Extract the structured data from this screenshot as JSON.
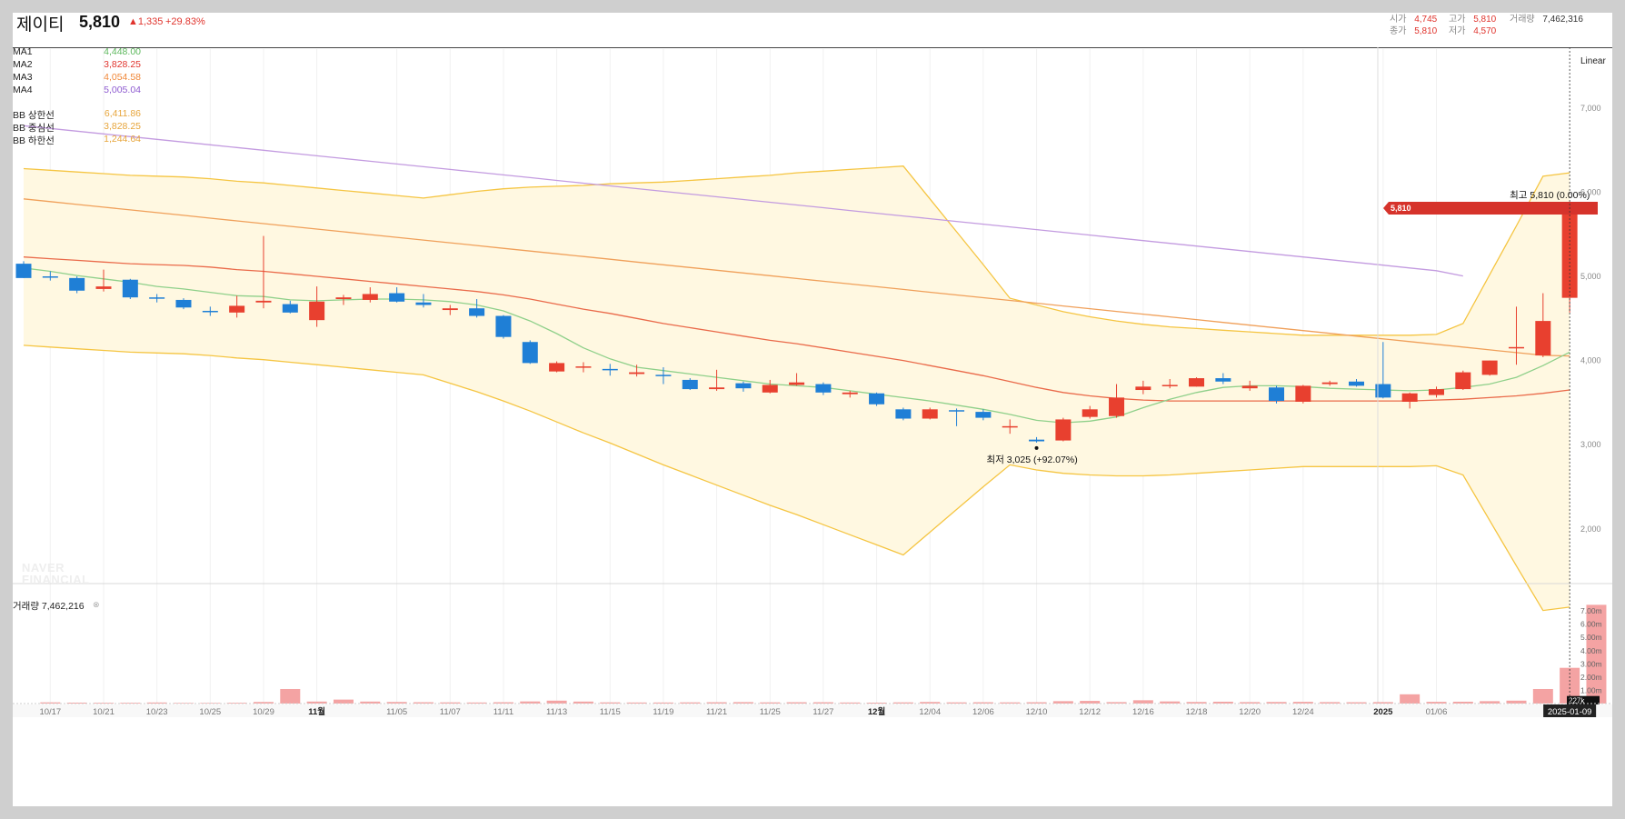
{
  "header": {
    "name": "제이티",
    "price": "5,810",
    "change": "▲1,335",
    "change_rate": "+29.83%",
    "open_label": "시가",
    "open_value": "4,745",
    "high_label": "고가",
    "high_value": "5,810",
    "volume_label": "거래량",
    "volume_value": "7,462,316",
    "close_label": "종가",
    "close_value": "5,810",
    "low_label": "저가",
    "low_value": "4,570"
  },
  "legend": [
    {
      "name": "MA1",
      "value": "4,448.00",
      "color": "#5cb85c"
    },
    {
      "name": "MA2",
      "value": "3,828.25",
      "color": "#e0342d"
    },
    {
      "name": "MA3",
      "value": "4,054.58",
      "color": "#f0883a"
    },
    {
      "name": "MA4",
      "value": "5,005.04",
      "color": "#8e5bd0"
    },
    {
      "name": "BB 상한선",
      "value": "6,411.86",
      "color": "#e7a53b"
    },
    {
      "name": "BB 중심선",
      "value": "3,828.25",
      "color": "#e7a53b"
    },
    {
      "name": "BB 하한선",
      "value": "1,244.64",
      "color": "#e7a53b"
    }
  ],
  "scale_mode": "Linear",
  "volume_legend": "거래량 7,462,216",
  "watermark": [
    "NAVER",
    "FINANCIAL"
  ],
  "colors": {
    "up": "#e8402f",
    "down": "#1f7fd6",
    "bb_band": "#f5c542",
    "bb_fill": "#fff8e1"
  },
  "chart_data": {
    "type": "candlestick",
    "price_axis_ticks": [
      "7,000",
      "6,000",
      "5,000",
      "4,000",
      "3,000",
      "2,000"
    ],
    "price_ylim": [
      1350,
      7700
    ],
    "volume_axis_ticks": [
      "7.00m",
      "6.00m",
      "5.00m",
      "4.00m",
      "3.00m",
      "2.00m",
      "1.00m"
    ],
    "volume_ylim": [
      0,
      7900000
    ],
    "x_tick_labels": [
      {
        "i": 1,
        "label": "10/17"
      },
      {
        "i": 3,
        "label": "10/21"
      },
      {
        "i": 5,
        "label": "10/23"
      },
      {
        "i": 7,
        "label": "10/25"
      },
      {
        "i": 9,
        "label": "10/29"
      },
      {
        "i": 11,
        "label": "11월"
      },
      {
        "i": 14,
        "label": "11/05"
      },
      {
        "i": 16,
        "label": "11/07"
      },
      {
        "i": 18,
        "label": "11/11"
      },
      {
        "i": 20,
        "label": "11/13"
      },
      {
        "i": 22,
        "label": "11/15"
      },
      {
        "i": 24,
        "label": "11/19"
      },
      {
        "i": 26,
        "label": "11/21"
      },
      {
        "i": 28,
        "label": "11/25"
      },
      {
        "i": 30,
        "label": "11/27"
      },
      {
        "i": 32,
        "label": "12월"
      },
      {
        "i": 34,
        "label": "12/04"
      },
      {
        "i": 36,
        "label": "12/06"
      },
      {
        "i": 38,
        "label": "12/10"
      },
      {
        "i": 40,
        "label": "12/12"
      },
      {
        "i": 42,
        "label": "12/16"
      },
      {
        "i": 44,
        "label": "12/18"
      },
      {
        "i": 46,
        "label": "12/20"
      },
      {
        "i": 48,
        "label": "12/24"
      },
      {
        "i": 51,
        "label": "2025"
      },
      {
        "i": 53,
        "label": "01/06"
      }
    ],
    "crosshair_date": "2025-01-09",
    "last_price_tag": "5,810",
    "last_volume_tag": "227k",
    "high_annotation": "최고 5,810 (0.00%)",
    "low_annotation": "최저 3,025 (+92.07%)",
    "candles": [
      {
        "o": 5150,
        "h": 5180,
        "l": 4980,
        "c": 4980
      },
      {
        "o": 5000,
        "h": 5060,
        "l": 4950,
        "c": 4990
      },
      {
        "o": 4980,
        "h": 5000,
        "l": 4800,
        "c": 4830
      },
      {
        "o": 4850,
        "h": 5080,
        "l": 4820,
        "c": 4880
      },
      {
        "o": 4960,
        "h": 4970,
        "l": 4730,
        "c": 4750
      },
      {
        "o": 4750,
        "h": 4790,
        "l": 4690,
        "c": 4740
      },
      {
        "o": 4720,
        "h": 4740,
        "l": 4610,
        "c": 4630
      },
      {
        "o": 4590,
        "h": 4640,
        "l": 4530,
        "c": 4580
      },
      {
        "o": 4570,
        "h": 4770,
        "l": 4510,
        "c": 4650
      },
      {
        "o": 4690,
        "h": 5480,
        "l": 4620,
        "c": 4710
      },
      {
        "o": 4670,
        "h": 4710,
        "l": 4560,
        "c": 4570
      },
      {
        "o": 4480,
        "h": 4880,
        "l": 4400,
        "c": 4700
      },
      {
        "o": 4730,
        "h": 4780,
        "l": 4660,
        "c": 4750
      },
      {
        "o": 4720,
        "h": 4870,
        "l": 4690,
        "c": 4790
      },
      {
        "o": 4800,
        "h": 4870,
        "l": 4690,
        "c": 4700
      },
      {
        "o": 4690,
        "h": 4790,
        "l": 4630,
        "c": 4660
      },
      {
        "o": 4600,
        "h": 4660,
        "l": 4540,
        "c": 4620
      },
      {
        "o": 4620,
        "h": 4730,
        "l": 4510,
        "c": 4530
      },
      {
        "o": 4530,
        "h": 4540,
        "l": 4260,
        "c": 4280
      },
      {
        "o": 4220,
        "h": 4240,
        "l": 3960,
        "c": 3970
      },
      {
        "o": 3870,
        "h": 3990,
        "l": 3860,
        "c": 3970
      },
      {
        "o": 3920,
        "h": 3980,
        "l": 3860,
        "c": 3930
      },
      {
        "o": 3900,
        "h": 3960,
        "l": 3820,
        "c": 3890
      },
      {
        "o": 3840,
        "h": 3950,
        "l": 3810,
        "c": 3860
      },
      {
        "o": 3830,
        "h": 3920,
        "l": 3720,
        "c": 3820
      },
      {
        "o": 3770,
        "h": 3790,
        "l": 3650,
        "c": 3660
      },
      {
        "o": 3660,
        "h": 3890,
        "l": 3640,
        "c": 3680
      },
      {
        "o": 3730,
        "h": 3750,
        "l": 3630,
        "c": 3670
      },
      {
        "o": 3620,
        "h": 3770,
        "l": 3610,
        "c": 3710
      },
      {
        "o": 3710,
        "h": 3850,
        "l": 3700,
        "c": 3740
      },
      {
        "o": 3720,
        "h": 3740,
        "l": 3590,
        "c": 3620
      },
      {
        "o": 3600,
        "h": 3640,
        "l": 3560,
        "c": 3620
      },
      {
        "o": 3610,
        "h": 3620,
        "l": 3460,
        "c": 3480
      },
      {
        "o": 3420,
        "h": 3440,
        "l": 3290,
        "c": 3310
      },
      {
        "o": 3310,
        "h": 3440,
        "l": 3300,
        "c": 3420
      },
      {
        "o": 3410,
        "h": 3430,
        "l": 3220,
        "c": 3400
      },
      {
        "o": 3390,
        "h": 3420,
        "l": 3290,
        "c": 3320
      },
      {
        "o": 3220,
        "h": 3300,
        "l": 3130,
        "c": 3220
      },
      {
        "o": 3060,
        "h": 3090,
        "l": 3025,
        "c": 3040
      },
      {
        "o": 3050,
        "h": 3320,
        "l": 3040,
        "c": 3300
      },
      {
        "o": 3330,
        "h": 3460,
        "l": 3310,
        "c": 3420
      },
      {
        "o": 3340,
        "h": 3720,
        "l": 3320,
        "c": 3560
      },
      {
        "o": 3650,
        "h": 3760,
        "l": 3600,
        "c": 3690
      },
      {
        "o": 3700,
        "h": 3780,
        "l": 3670,
        "c": 3710
      },
      {
        "o": 3690,
        "h": 3800,
        "l": 3690,
        "c": 3790
      },
      {
        "o": 3790,
        "h": 3850,
        "l": 3720,
        "c": 3750
      },
      {
        "o": 3670,
        "h": 3760,
        "l": 3640,
        "c": 3700
      },
      {
        "o": 3680,
        "h": 3700,
        "l": 3490,
        "c": 3520
      },
      {
        "o": 3510,
        "h": 3710,
        "l": 3490,
        "c": 3700
      },
      {
        "o": 3720,
        "h": 3760,
        "l": 3700,
        "c": 3740
      },
      {
        "o": 3750,
        "h": 3780,
        "l": 3690,
        "c": 3700
      },
      {
        "o": 3720,
        "h": 4220,
        "l": 3550,
        "c": 3560
      },
      {
        "o": 3510,
        "h": 3620,
        "l": 3430,
        "c": 3610
      },
      {
        "o": 3590,
        "h": 3690,
        "l": 3560,
        "c": 3660
      },
      {
        "o": 3660,
        "h": 3880,
        "l": 3650,
        "c": 3860
      },
      {
        "o": 3830,
        "h": 4000,
        "l": 3820,
        "c": 4000
      },
      {
        "o": 4150,
        "h": 4640,
        "l": 3950,
        "c": 4160
      },
      {
        "o": 4060,
        "h": 4800,
        "l": 4040,
        "c": 4470
      },
      {
        "o": 4745,
        "h": 5810,
        "l": 4570,
        "c": 5810
      }
    ],
    "volume": [
      90000,
      70000,
      60000,
      60000,
      80000,
      50000,
      50000,
      60000,
      120000,
      1100000,
      150000,
      300000,
      150000,
      120000,
      100000,
      90000,
      80000,
      100000,
      160000,
      220000,
      150000,
      90000,
      80000,
      80000,
      90000,
      100000,
      110000,
      90000,
      100000,
      100000,
      80000,
      70000,
      90000,
      120000,
      90000,
      100000,
      90000,
      100000,
      180000,
      200000,
      110000,
      250000,
      160000,
      120000,
      140000,
      110000,
      120000,
      130000,
      110000,
      100000,
      110000,
      700000,
      130000,
      140000,
      180000,
      220000,
      1100000,
      2700000,
      7462316
    ],
    "ma1": [
      5100,
      5060,
      5010,
      4970,
      4930,
      4880,
      4850,
      4810,
      4770,
      4760,
      4720,
      4710,
      4720,
      4730,
      4730,
      4720,
      4700,
      4660,
      4590,
      4470,
      4320,
      4150,
      4020,
      3920,
      3880,
      3840,
      3800,
      3760,
      3720,
      3700,
      3680,
      3640,
      3600,
      3560,
      3520,
      3470,
      3420,
      3360,
      3290,
      3260,
      3280,
      3330,
      3440,
      3540,
      3620,
      3680,
      3700,
      3700,
      3690,
      3670,
      3660,
      3650,
      3640,
      3650,
      3680,
      3720,
      3800,
      3940,
      4100,
      4448
    ],
    "ma2": [
      5230,
      5210,
      5190,
      5170,
      5150,
      5140,
      5130,
      5110,
      5080,
      5060,
      5030,
      5000,
      4970,
      4940,
      4910,
      4880,
      4850,
      4820,
      4780,
      4730,
      4670,
      4610,
      4560,
      4500,
      4440,
      4390,
      4340,
      4290,
      4240,
      4200,
      4150,
      4100,
      4050,
      4000,
      3940,
      3880,
      3820,
      3750,
      3680,
      3620,
      3580,
      3550,
      3530,
      3520,
      3520,
      3520,
      3520,
      3520,
      3520,
      3520,
      3520,
      3520,
      3520,
      3530,
      3540,
      3560,
      3580,
      3610,
      3650,
      3700,
      3828
    ]
  }
}
